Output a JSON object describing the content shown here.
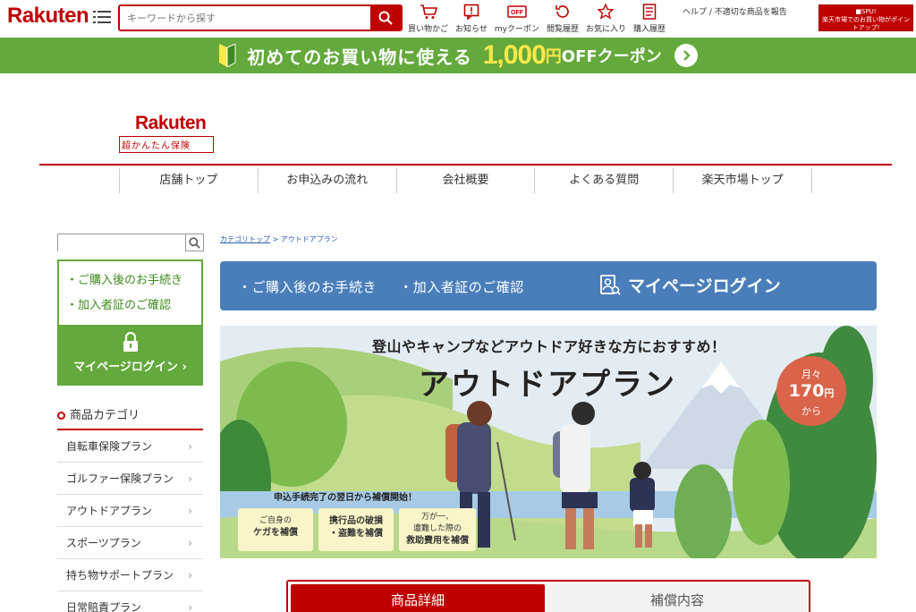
{
  "global_header": {
    "logo": "Rakuten",
    "search_placeholder": "キーワードから探す",
    "icons": [
      {
        "label": "買い物かご",
        "icon": "cart-icon"
      },
      {
        "label": "お知らせ",
        "icon": "notice-icon"
      },
      {
        "label": "myクーポン",
        "icon": "coupon-icon"
      },
      {
        "label": "閲覧履歴",
        "icon": "history-icon"
      },
      {
        "label": "お気に入り",
        "icon": "star-icon"
      },
      {
        "label": "購入履歴",
        "icon": "receipt-icon"
      }
    ],
    "help_link": "ヘルプ",
    "report_link": "不適切な商品を報告",
    "spu_banner": "楽天市場でのお買い物がポイントアップ!"
  },
  "coupon_banner": {
    "text": "初めてのお買い物に使える",
    "amount": "1,000",
    "unit": "円",
    "off": "OFFクーポン"
  },
  "site": {
    "logo_top": "Rakuten",
    "logo_sub": "超かんたん保険"
  },
  "nav": {
    "items": [
      "店舗トップ",
      "お申込みの流れ",
      "会社概要",
      "よくある質問",
      "楽天市場トップ"
    ]
  },
  "sidebar": {
    "links": [
      "・ご購入後のお手続き",
      "・加入者証のご確認"
    ],
    "login_label": "マイページログイン",
    "category_title": "商品カテゴリ",
    "categories": [
      "自転車保険プラン",
      "ゴルファー保険プラン",
      "アウトドアプラン",
      "スポーツプラン",
      "持ち物サポートプラン",
      "日常賠責プラン"
    ]
  },
  "breadcrumb": {
    "root": "カテゴリトップ",
    "separator": ">",
    "current": "アウトドアプラン"
  },
  "mypage_bar": {
    "link1": "・ご購入後のお手続き",
    "link2": "・加入者証のご確認",
    "login": "マイページログイン"
  },
  "hero": {
    "subtitle": "登山やキャンプなどアウトドア好きな方におすすめ！",
    "title": "アウトドアプラン",
    "badge_line1": "月々",
    "badge_price": "170",
    "badge_unit": "円",
    "badge_line3": "から",
    "note": "申込手続完了の翌日から補償開始！",
    "tags": [
      {
        "line1": "ご自身の",
        "line2": "ケガを補償"
      },
      {
        "line1": "携行品の破損",
        "line2": "・盗難を補償"
      },
      {
        "line1": "万が一、",
        "line2": "遭難した際の",
        "line3": "救助費用を補償"
      }
    ]
  },
  "tabs": {
    "active": "商品詳細",
    "inactive": "補償内容"
  },
  "colors": {
    "rakuten_red": "#bf0000",
    "green": "#63a93b",
    "blue": "#4a7eba",
    "badge": "#d9644a"
  }
}
